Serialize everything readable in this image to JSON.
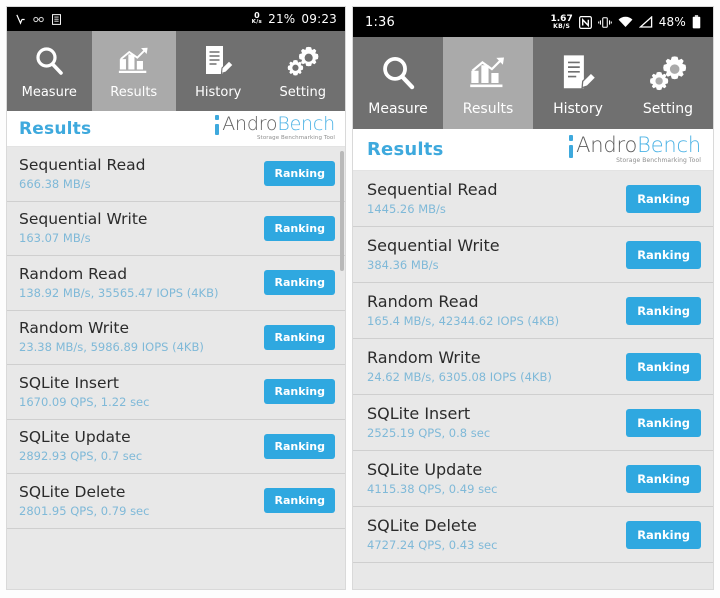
{
  "app": {
    "title": "AndroBench",
    "logo": {
      "part1": "Andro",
      "part2": "Bench",
      "subtitle": "Storage Benchmarking Tool"
    },
    "section_title": "Results",
    "ranking_label": "Ranking",
    "accent_color": "#2fa8e0",
    "title_color": "#3ea9dd",
    "value_color": "#7fb9d8",
    "tab_active_bg": "#aaaaaa",
    "tab_inactive_bg": "#707070"
  },
  "tabs": [
    {
      "id": "measure",
      "label": "Measure",
      "icon": "magnifier-icon",
      "active": false
    },
    {
      "id": "results",
      "label": "Results",
      "icon": "bar-chart-icon",
      "active": true
    },
    {
      "id": "history",
      "label": "History",
      "icon": "document-pencil-icon",
      "active": false
    },
    {
      "id": "setting",
      "label": "Setting",
      "icon": "gears-icon",
      "active": false
    }
  ],
  "left_phone": {
    "statusbar": {
      "icons_left": [
        "vpn-icon",
        "key-icon",
        "list-icon"
      ],
      "net_speed_value": "0",
      "net_speed_unit": "K/s",
      "battery": "21%",
      "clock": "09:23"
    },
    "rows": [
      {
        "name": "Sequential Read",
        "value": "666.38 MB/s"
      },
      {
        "name": "Sequential Write",
        "value": "163.07 MB/s"
      },
      {
        "name": "Random Read",
        "value": "138.92 MB/s, 35565.47 IOPS (4KB)"
      },
      {
        "name": "Random Write",
        "value": "23.38 MB/s, 5986.89 IOPS (4KB)"
      },
      {
        "name": "SQLite Insert",
        "value": "1670.09 QPS, 1.22 sec"
      },
      {
        "name": "SQLite Update",
        "value": "2892.93 QPS, 0.7 sec"
      },
      {
        "name": "SQLite Delete",
        "value": "2801.95 QPS, 0.79 sec"
      }
    ]
  },
  "right_phone": {
    "statusbar": {
      "clock": "1:36",
      "net_speed_value": "1.67",
      "net_speed_unit": "KB/S",
      "icons_right": [
        "nfc-icon",
        "vibrate-icon",
        "wifi-icon",
        "signal-icon"
      ],
      "battery": "48%"
    },
    "rows": [
      {
        "name": "Sequential Read",
        "value": "1445.26 MB/s"
      },
      {
        "name": "Sequential Write",
        "value": "384.36 MB/s"
      },
      {
        "name": "Random Read",
        "value": "165.4 MB/s, 42344.62 IOPS (4KB)"
      },
      {
        "name": "Random Write",
        "value": "24.62 MB/s, 6305.08 IOPS (4KB)"
      },
      {
        "name": "SQLite Insert",
        "value": "2525.19 QPS, 0.8 sec"
      },
      {
        "name": "SQLite Update",
        "value": "4115.38 QPS, 0.49 sec"
      },
      {
        "name": "SQLite Delete",
        "value": "4727.24 QPS, 0.43 sec"
      }
    ]
  }
}
